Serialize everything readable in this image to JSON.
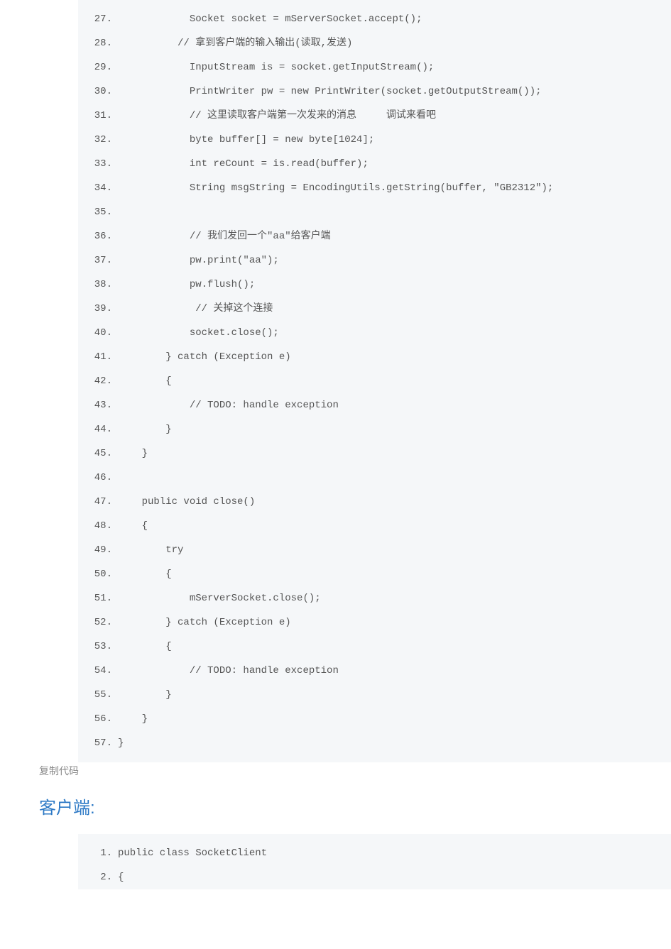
{
  "copyLabel": "复制代码",
  "sectionHeader": "客户端:",
  "block1": {
    "startLine": 27,
    "lines": [
      "            Socket socket = mServerSocket.accept();",
      "          // 拿到客户端的输入输出(读取,发送)",
      "            InputStream is = socket.getInputStream();",
      "            PrintWriter pw = new PrintWriter(socket.getOutputStream());",
      "            // 这里读取客户端第一次发来的消息     调试来看吧",
      "            byte buffer[] = new byte[1024];",
      "            int reCount = is.read(buffer);",
      "            String msgString = EncodingUtils.getString(buffer, \"GB2312\");",
      "",
      "            // 我们发回一个\"aa\"给客户端",
      "            pw.print(\"aa\");",
      "            pw.flush();",
      "             // 关掉这个连接",
      "            socket.close();",
      "        } catch (Exception e)",
      "        {",
      "            // TODO: handle exception",
      "        }",
      "    }",
      "",
      "    public void close()",
      "    {",
      "        try",
      "        {",
      "            mServerSocket.close();",
      "        } catch (Exception e)",
      "        {",
      "            // TODO: handle exception",
      "        }",
      "    }",
      "}"
    ]
  },
  "block2": {
    "startLine": 1,
    "lines": [
      "public class SocketClient",
      "{"
    ]
  }
}
